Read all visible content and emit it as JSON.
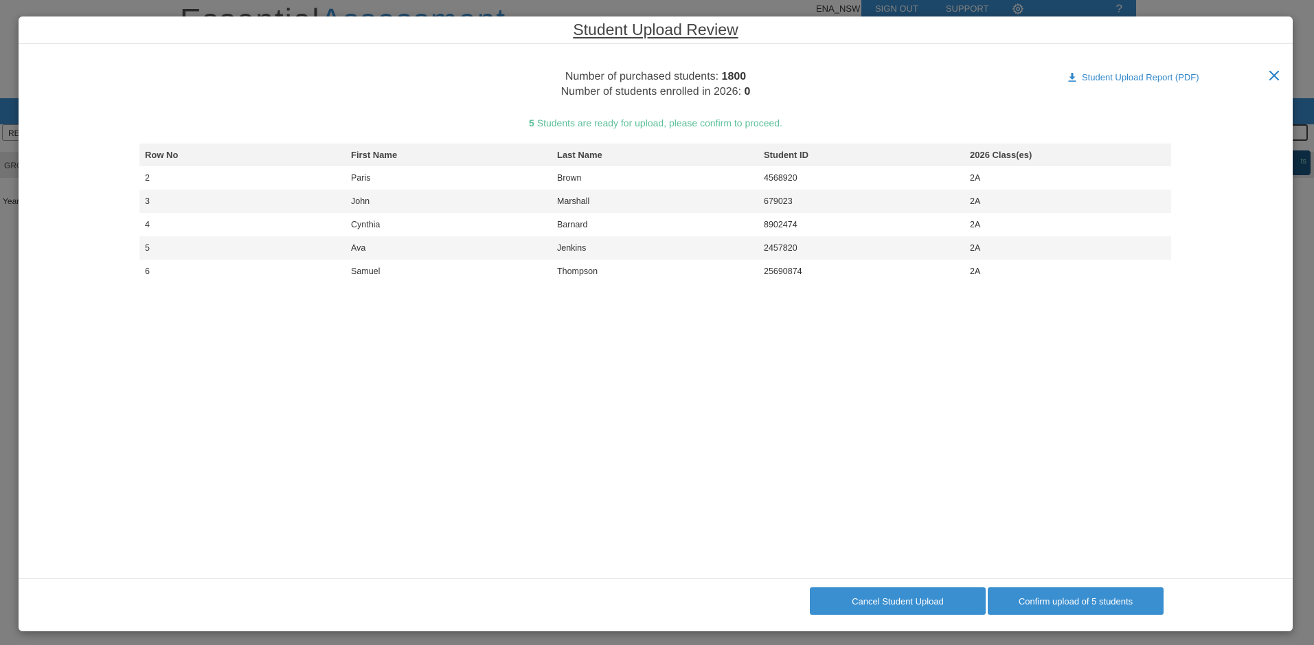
{
  "background": {
    "logo_part1": "Essential",
    "logo_part2": "Assessment",
    "username": "ENA_NSW",
    "topbar": {
      "sign_out": "SIGN OUT",
      "support": "SUPPORT",
      "help": "?"
    },
    "left_input_text": "RE",
    "group_label": "GRO",
    "year_label": "Year",
    "right_button_text": "ts"
  },
  "modal": {
    "title": "Student Upload Review",
    "purchased_label": "Number of purchased students:",
    "purchased_value": "1800",
    "enrolled_label": "Number of students enrolled in 2026:",
    "enrolled_value": "0",
    "report_link": "Student Upload Report (PDF)",
    "ready_count": "5",
    "ready_text": "Students are ready for upload, please confirm to proceed.",
    "columns": [
      "Row No",
      "First Name",
      "Last Name",
      "Student ID",
      "2026 Class(es)"
    ],
    "rows": [
      [
        "2",
        "Paris",
        "Brown",
        "4568920",
        "2A"
      ],
      [
        "3",
        "John",
        "Marshall",
        "679023",
        "2A"
      ],
      [
        "4",
        "Cynthia",
        "Barnard",
        "8902474",
        "2A"
      ],
      [
        "5",
        "Ava",
        "Jenkins",
        "2457820",
        "2A"
      ],
      [
        "6",
        "Samuel",
        "Thompson",
        "25690874",
        "2A"
      ]
    ],
    "cancel_button": "Cancel Student Upload",
    "confirm_button": "Confirm upload of 5 students"
  },
  "icons": {
    "close": "close-icon",
    "download": "download-icon",
    "settings": "gear-icon"
  },
  "colors": {
    "accent": "#3a8fd0",
    "success": "#5bbf9a",
    "link": "#2f86c9"
  }
}
